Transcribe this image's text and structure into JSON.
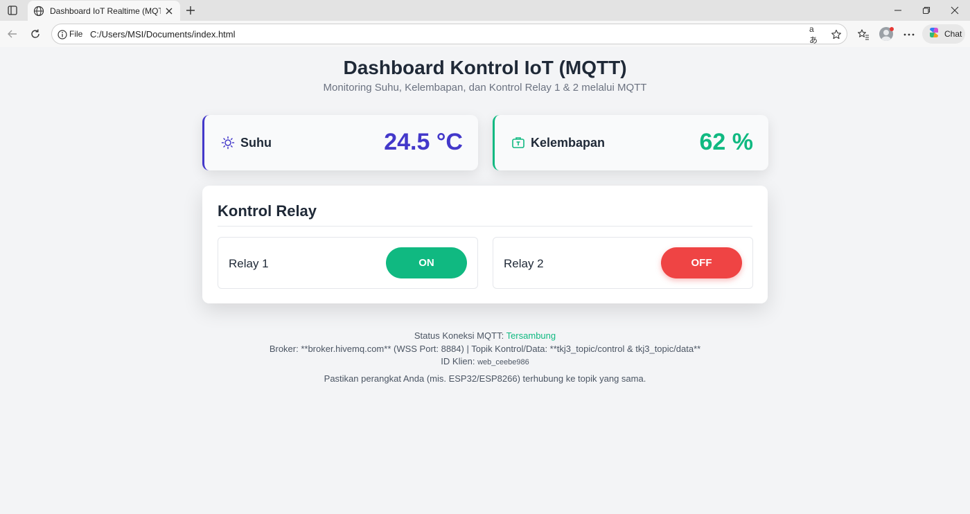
{
  "browser": {
    "tab_title": "Dashboard IoT Realtime (MQTT -",
    "url_scheme_label": "File",
    "url": "C:/Users/MSI/Documents/index.html",
    "chat_label": "Chat"
  },
  "header": {
    "title": "Dashboard Kontrol IoT (MQTT)",
    "subtitle": "Monitoring Suhu, Kelembapan, dan Kontrol Relay 1 & 2 melalui MQTT"
  },
  "sensors": [
    {
      "label": "Suhu",
      "value": "24.5 °C",
      "icon": "sun-icon",
      "color": "#4338ca"
    },
    {
      "label": "Kelembapan",
      "value": "62 %",
      "icon": "droplet-box-icon",
      "color": "#10b981"
    }
  ],
  "relay_panel": {
    "heading": "Kontrol Relay",
    "relays": [
      {
        "label": "Relay 1",
        "state": "ON",
        "color": "#10b981"
      },
      {
        "label": "Relay 2",
        "state": "OFF",
        "color": "#ef4444"
      }
    ]
  },
  "status": {
    "connection_prefix": "Status Koneksi MQTT:",
    "connection_value": "Tersambung",
    "broker_line": "Broker: **broker.hivemq.com** (WSS Port: 8884) | Topik Kontrol/Data: **tkj3_topic/control & tkj3_topic/data**",
    "client_prefix": "ID Klien:",
    "client_id": "web_ceebe986",
    "note": "Pastikan perangkat Anda (mis. ESP32/ESP8266) terhubung ke topik yang sama."
  }
}
